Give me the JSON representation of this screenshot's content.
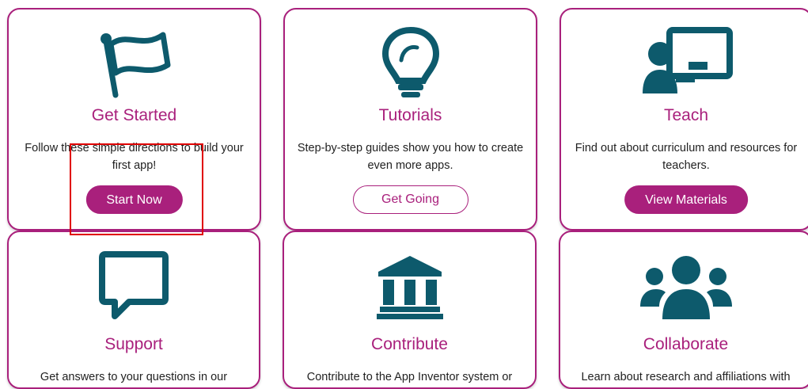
{
  "colors": {
    "accent": "#a9207c",
    "icon": "#0d5a6c",
    "highlight": "#e00000"
  },
  "cards": [
    {
      "title": "Get Started",
      "text": "Follow these simple directions to build your first app!",
      "button": "Start Now",
      "icon": "flag-icon"
    },
    {
      "title": "Tutorials",
      "text": "Step-by-step guides show you how to create even more apps.",
      "button": "Get Going",
      "icon": "lightbulb-icon"
    },
    {
      "title": "Teach",
      "text": "Find out about curriculum and resources for teachers.",
      "button": "View Materials",
      "icon": "teacher-icon"
    },
    {
      "title": "Support",
      "text": "Get answers to your questions in our",
      "icon": "speech-bubble-icon"
    },
    {
      "title": "Contribute",
      "text": "Contribute to the App Inventor system or",
      "icon": "institution-icon"
    },
    {
      "title": "Collaborate",
      "text": "Learn about research and affiliations with",
      "icon": "users-group-icon"
    }
  ]
}
